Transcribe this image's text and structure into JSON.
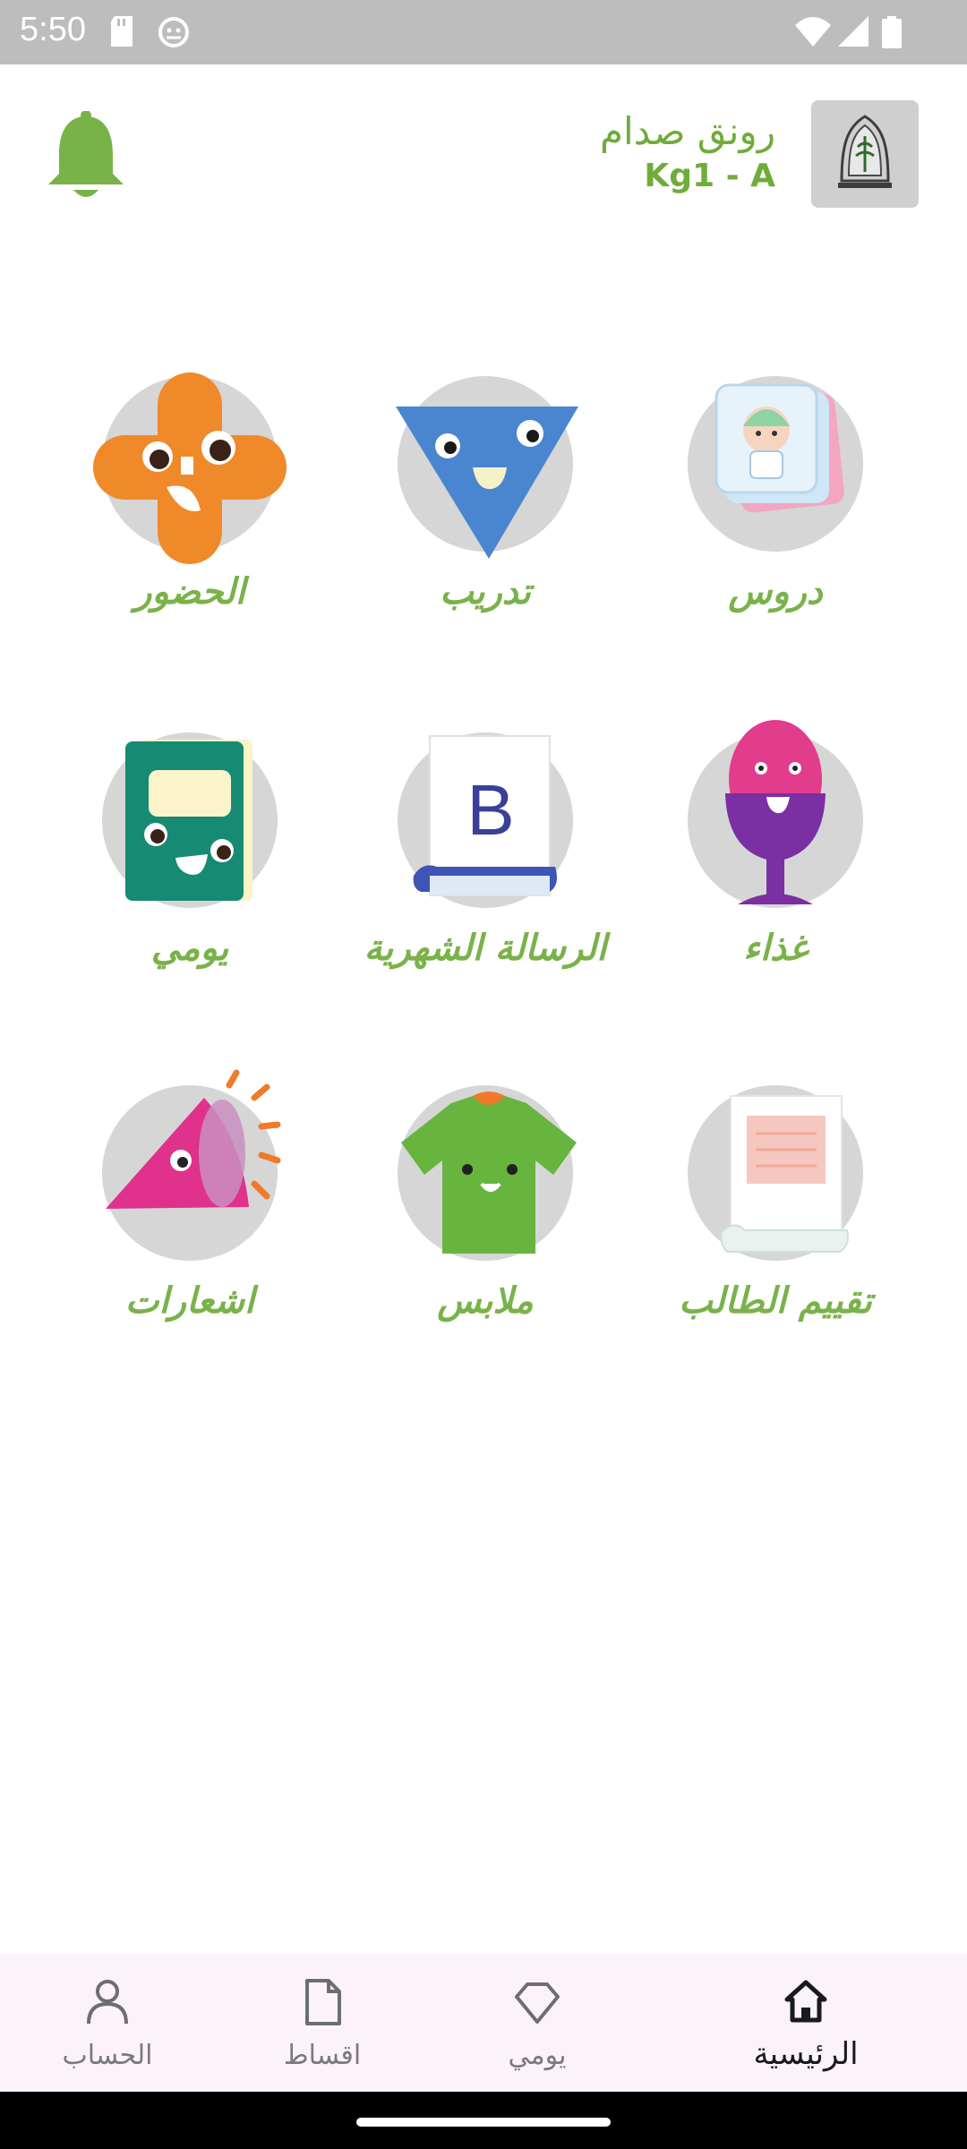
{
  "status_bar": {
    "time": "5:50",
    "icons": [
      "sd-card-icon",
      "android-icon",
      "wifi-icon",
      "signal-icon",
      "battery-icon"
    ]
  },
  "header": {
    "student_name": "رونق صدام",
    "student_class": "Kg1 - A",
    "logo_icon": "school-emblem-icon",
    "bell_icon": "notification-bell-icon"
  },
  "colors": {
    "accent_green": "#7ab24a",
    "tile_circle": "#d6d6d6",
    "nav_background": "#fcf3fa"
  },
  "menu": [
    {
      "label": "دروس",
      "icon": "lessons-cards-icon"
    },
    {
      "label": "تدريب",
      "icon": "training-triangle-icon"
    },
    {
      "label": "الحضور",
      "icon": "attendance-cross-icon"
    },
    {
      "label": "غذاء",
      "icon": "food-egg-cup-icon"
    },
    {
      "label": "الرسالة الشهرية",
      "icon": "monthly-letter-icon"
    },
    {
      "label": "يومي",
      "icon": "daily-notebook-icon"
    },
    {
      "label": "تقييم الطالب",
      "icon": "student-evaluation-icon"
    },
    {
      "label": "ملابس",
      "icon": "clothes-shirt-icon"
    },
    {
      "label": "اشعارات",
      "icon": "announcements-megaphone-icon"
    }
  ],
  "bottom_nav": [
    {
      "label": "الرئيسية",
      "icon": "home-icon",
      "active": true
    },
    {
      "label": "يومي",
      "icon": "diamond-icon",
      "active": false
    },
    {
      "label": "اقساط",
      "icon": "document-icon",
      "active": false
    },
    {
      "label": "الحساب",
      "icon": "person-icon",
      "active": false
    }
  ]
}
